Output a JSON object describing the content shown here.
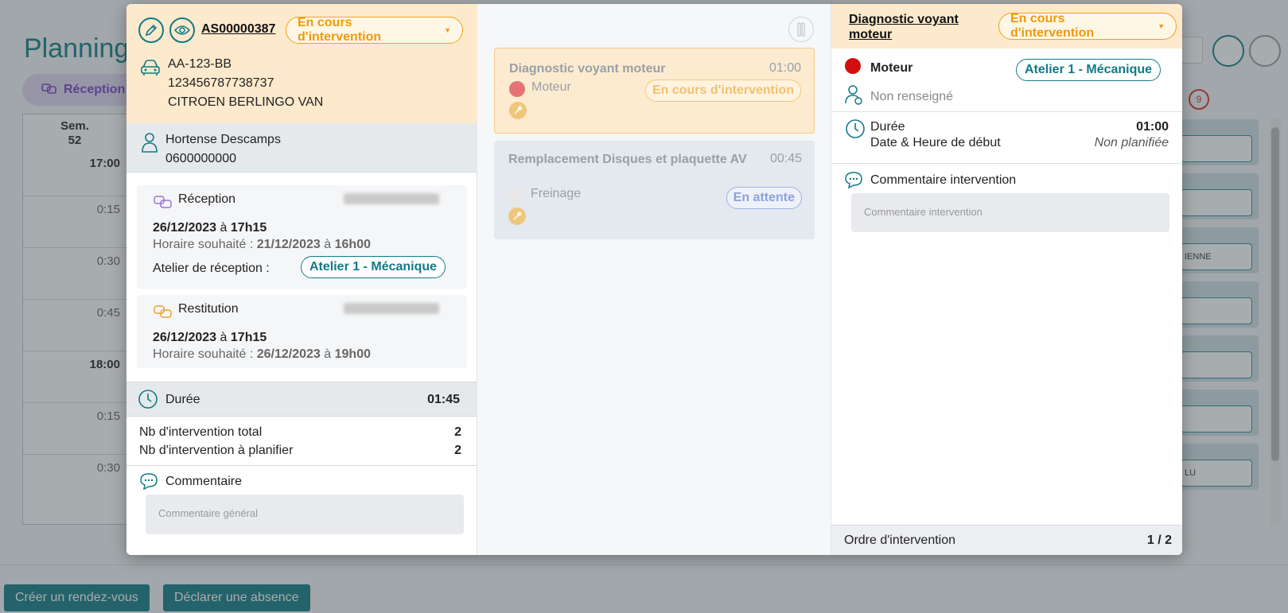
{
  "background": {
    "page_title": "Planning",
    "tab_reception": "Réception",
    "week_label": "Sem.",
    "week_number": "52",
    "time_rows": [
      "17:00",
      "0:15",
      "0:30",
      "0:45",
      "18:00",
      "0:15",
      "0:30"
    ],
    "alert_count": "9",
    "card_snippets": [
      "",
      "",
      "IENNE",
      "",
      "",
      "",
      "LU"
    ],
    "btn_create": "Créer un rendez-vous",
    "btn_absence": "Déclarer une absence"
  },
  "order": {
    "reference": "AS00000387",
    "status": "En cours d'intervention",
    "vehicle": {
      "plate": "AA-123-BB",
      "vin": "123456787738737",
      "model": "CITROEN BERLINGO VAN"
    },
    "customer": {
      "name": "Hortense Descamps",
      "phone": "0600000000"
    },
    "reception": {
      "title": "Réception",
      "date": "26/12/2023",
      "sep": "à",
      "time": "17h15",
      "wish_label": "Horaire souhaité :",
      "wish_date": "21/12/2023",
      "wish_time": "16h00",
      "workshop_label": "Atelier de réception :",
      "workshop": "Atelier 1 - Mécanique"
    },
    "restitution": {
      "title": "Restitution",
      "date": "26/12/2023",
      "sep": "à",
      "time": "17h15",
      "wish_label": "Horaire souhaité :",
      "wish_date": "26/12/2023",
      "wish_time": "19h00"
    },
    "duration_label": "Durée",
    "duration": "01:45",
    "total_label": "Nb d'intervention total",
    "total": "2",
    "to_plan_label": "Nb d'intervention à planifier",
    "to_plan": "2",
    "comment_label": "Commentaire",
    "comment_placeholder": "Commentaire général"
  },
  "interventions": [
    {
      "title": "Diagnostic voyant moteur",
      "duration": "01:00",
      "category": "Moteur",
      "status": "En cours d'intervention"
    },
    {
      "title": "Remplacement Disques et plaquette AV",
      "duration": "00:45",
      "category": "Freinage",
      "status": "En attente"
    }
  ],
  "detail": {
    "title": "Diagnostic voyant moteur",
    "status": "En cours d'intervention",
    "category": "Moteur",
    "workshop": "Atelier 1 - Mécanique",
    "technician": "Non renseigné",
    "duration_label": "Durée",
    "duration": "01:00",
    "start_label": "Date & Heure de début",
    "start_value": "Non planifiée",
    "comment_label": "Commentaire intervention",
    "comment_placeholder": "Commentaire intervention",
    "order_label": "Ordre d'intervention",
    "order_value": "1 / 2"
  },
  "colors": {
    "teal": "#127a86",
    "orange": "#ee9a0c",
    "header_bg": "#fde9cc",
    "red": "#d10f0f"
  }
}
